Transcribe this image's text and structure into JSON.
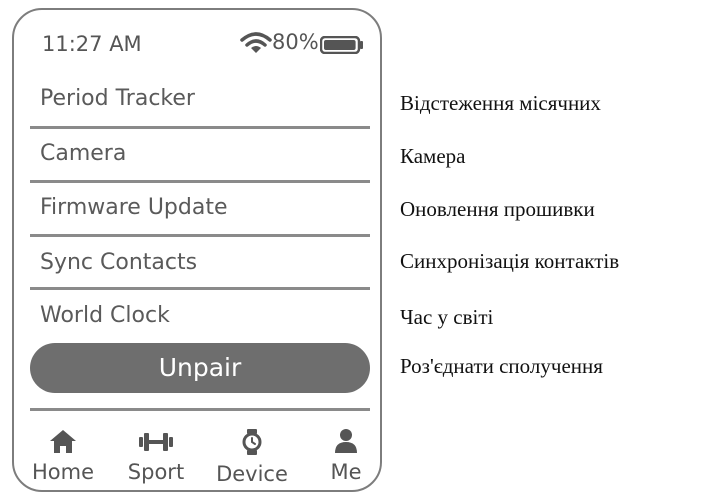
{
  "status_bar": {
    "time": "11:27 AM",
    "battery": "80%",
    "battery_level": 0.8,
    "wifi_icon": "wifi-icon",
    "battery_icon": "battery-icon"
  },
  "menu": {
    "items": [
      {
        "label": "Period Tracker"
      },
      {
        "label": "Camera"
      },
      {
        "label": "Firmware Update"
      },
      {
        "label": "Sync Contacts"
      },
      {
        "label": "World Clock"
      }
    ],
    "unpair_label": "Unpair"
  },
  "tabs": [
    {
      "label": "Home",
      "icon": "home-icon"
    },
    {
      "label": "Sport",
      "icon": "dumbbell-icon"
    },
    {
      "label": "Device",
      "icon": "watch-icon"
    },
    {
      "label": "Me",
      "icon": "person-icon"
    }
  ],
  "translations": [
    "Відстеження місячних",
    "Камера",
    "Оновлення прошивки",
    "Синхронізація контактів",
    "Час у світі",
    "Роз'єднати сполучення"
  ],
  "colors": {
    "button_fill": "#6e6e6e",
    "text_gray": "#555555",
    "frame": "#7d7d7d"
  }
}
